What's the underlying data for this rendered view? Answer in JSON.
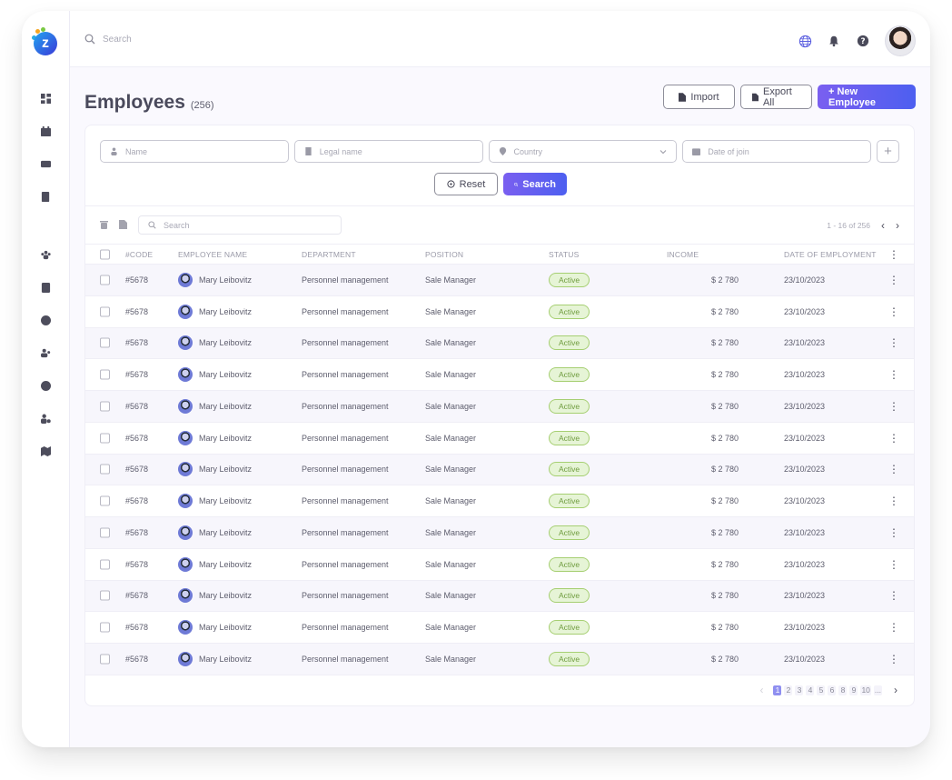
{
  "brand": {
    "logo_letter": "z",
    "accent": "#6a5ff0"
  },
  "topbar": {
    "search_placeholder": "Search",
    "icons": [
      "globe-icon",
      "bell-icon",
      "help-icon",
      "user-avatar"
    ]
  },
  "sidebar": {
    "items": [
      {
        "icon": "dashboard-icon"
      },
      {
        "icon": "calendar-icon"
      },
      {
        "icon": "mail-icon"
      },
      {
        "icon": "document-edit-icon"
      },
      {
        "icon": "team-icon"
      },
      {
        "icon": "list-icon"
      },
      {
        "icon": "parking-icon"
      },
      {
        "icon": "users-icon"
      },
      {
        "icon": "dollar-icon"
      },
      {
        "icon": "user-settings-icon"
      },
      {
        "icon": "map-icon"
      }
    ]
  },
  "page": {
    "title": "Employees",
    "count": "(256)",
    "import_label": "Import",
    "export_label": "Export All",
    "new_label": "+ New Employee"
  },
  "filters": {
    "name_placeholder": "Name",
    "legal_placeholder": "Legal name",
    "country_placeholder": "Country",
    "date_placeholder": "Date of join",
    "add_label": "+",
    "reset_label": "Reset",
    "search_label": "Search"
  },
  "table": {
    "search_placeholder": "Search",
    "range": "1 - 16 of 256",
    "columns": [
      "#CODE",
      "EMPLOYEE NAME",
      "DEPARTMENT",
      "POSITION",
      "STATUS",
      "INCOME",
      "DATE OF EMPLOYMENT"
    ],
    "rows": [
      {
        "code": "#5678",
        "name": "Mary Leibovitz",
        "department": "Personnel management",
        "position": "Sale Manager",
        "status": "Active",
        "income": "$ 2 780",
        "date": "23/10/2023"
      },
      {
        "code": "#5678",
        "name": "Mary Leibovitz",
        "department": "Personnel management",
        "position": "Sale Manager",
        "status": "Active",
        "income": "$ 2 780",
        "date": "23/10/2023"
      },
      {
        "code": "#5678",
        "name": "Mary Leibovitz",
        "department": "Personnel management",
        "position": "Sale Manager",
        "status": "Active",
        "income": "$ 2 780",
        "date": "23/10/2023"
      },
      {
        "code": "#5678",
        "name": "Mary Leibovitz",
        "department": "Personnel management",
        "position": "Sale Manager",
        "status": "Active",
        "income": "$ 2 780",
        "date": "23/10/2023"
      },
      {
        "code": "#5678",
        "name": "Mary Leibovitz",
        "department": "Personnel management",
        "position": "Sale Manager",
        "status": "Active",
        "income": "$ 2 780",
        "date": "23/10/2023"
      },
      {
        "code": "#5678",
        "name": "Mary Leibovitz",
        "department": "Personnel management",
        "position": "Sale Manager",
        "status": "Active",
        "income": "$ 2 780",
        "date": "23/10/2023"
      },
      {
        "code": "#5678",
        "name": "Mary Leibovitz",
        "department": "Personnel management",
        "position": "Sale Manager",
        "status": "Active",
        "income": "$ 2 780",
        "date": "23/10/2023"
      },
      {
        "code": "#5678",
        "name": "Mary Leibovitz",
        "department": "Personnel management",
        "position": "Sale Manager",
        "status": "Active",
        "income": "$ 2 780",
        "date": "23/10/2023"
      },
      {
        "code": "#5678",
        "name": "Mary Leibovitz",
        "department": "Personnel management",
        "position": "Sale Manager",
        "status": "Active",
        "income": "$ 2 780",
        "date": "23/10/2023"
      },
      {
        "code": "#5678",
        "name": "Mary Leibovitz",
        "department": "Personnel management",
        "position": "Sale Manager",
        "status": "Active",
        "income": "$ 2 780",
        "date": "23/10/2023"
      },
      {
        "code": "#5678",
        "name": "Mary Leibovitz",
        "department": "Personnel management",
        "position": "Sale Manager",
        "status": "Active",
        "income": "$ 2 780",
        "date": "23/10/2023"
      },
      {
        "code": "#5678",
        "name": "Mary Leibovitz",
        "department": "Personnel management",
        "position": "Sale Manager",
        "status": "Active",
        "income": "$ 2 780",
        "date": "23/10/2023"
      },
      {
        "code": "#5678",
        "name": "Mary Leibovitz",
        "department": "Personnel management",
        "position": "Sale Manager",
        "status": "Active",
        "income": "$ 2 780",
        "date": "23/10/2023"
      }
    ]
  },
  "pagination": {
    "pages": [
      "1",
      "2",
      "3",
      "4",
      "5",
      "6",
      "8",
      "9",
      "10",
      "..."
    ],
    "current": "1"
  }
}
